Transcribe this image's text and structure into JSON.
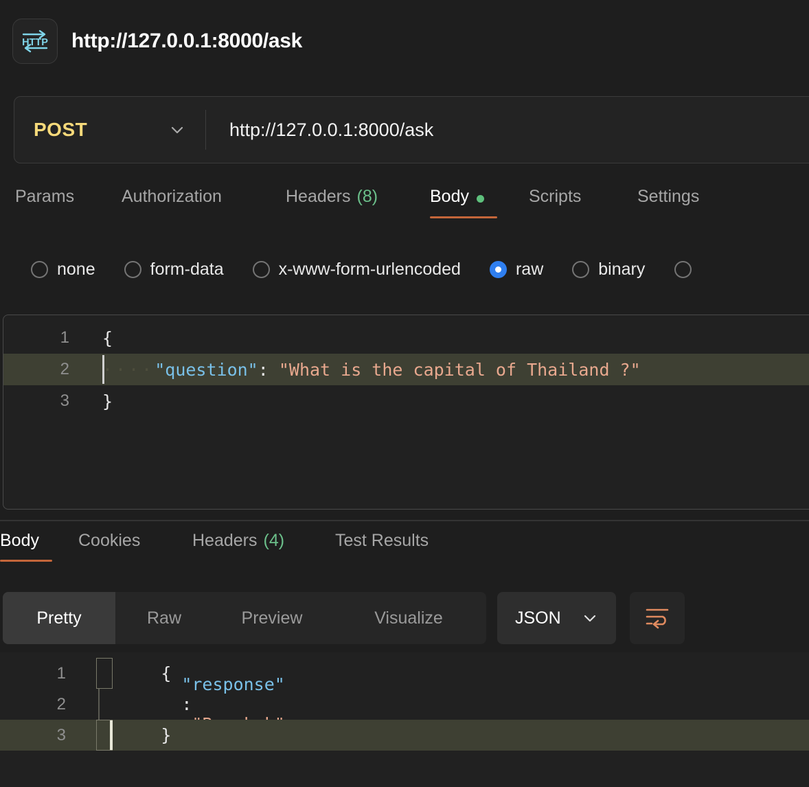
{
  "window": {
    "icon_name": "http-protocol-icon",
    "icon_text": "HTTP",
    "title": "http://127.0.0.1:8000/ask"
  },
  "url_bar": {
    "method": "POST",
    "method_chevron_icon": "chevron-down-icon",
    "url": "http://127.0.0.1:8000/ask"
  },
  "request_tabs": [
    {
      "label": "Params",
      "active": false
    },
    {
      "label": "Authorization",
      "active": false
    },
    {
      "label": "Headers",
      "count": "(8)",
      "active": false
    },
    {
      "label": "Body",
      "active": true,
      "dot": true
    },
    {
      "label": "Scripts",
      "active": false
    },
    {
      "label": "Settings",
      "active": false
    }
  ],
  "body_types": [
    {
      "label": "none",
      "selected": false
    },
    {
      "label": "form-data",
      "selected": false
    },
    {
      "label": "x-www-form-urlencoded",
      "selected": false
    },
    {
      "label": "raw",
      "selected": true
    },
    {
      "label": "binary",
      "selected": false
    }
  ],
  "request_body": {
    "lines": [
      {
        "num": "1",
        "indent_dots": "",
        "key": "",
        "colon": "",
        "value": "",
        "brace": "{",
        "highlight": false
      },
      {
        "num": "2",
        "indent_dots": "····",
        "key": "\"question\"",
        "colon": ":",
        "value": " \"What is the capital of Thailand ?\"",
        "brace": "",
        "highlight": true
      },
      {
        "num": "3",
        "indent_dots": "",
        "key": "",
        "colon": "",
        "value": "",
        "brace": "}",
        "highlight": false
      }
    ]
  },
  "response_tabs": [
    {
      "label": "Body",
      "active": true
    },
    {
      "label": "Cookies",
      "active": false
    },
    {
      "label": "Headers",
      "count": "(4)",
      "active": false
    },
    {
      "label": "Test Results",
      "active": false
    }
  ],
  "response_toolbar": {
    "views": [
      {
        "label": "Pretty",
        "active": true
      },
      {
        "label": "Raw",
        "active": false
      },
      {
        "label": "Preview",
        "active": false
      },
      {
        "label": "Visualize",
        "active": false
      }
    ],
    "format": "JSON",
    "format_chevron_icon": "chevron-down-icon",
    "wrap_icon": "word-wrap-icon"
  },
  "response_body": {
    "lines": [
      {
        "num": "1",
        "key": "",
        "colon": "",
        "value": "",
        "brace": "{",
        "highlight": false
      },
      {
        "num": "2",
        "key": "\"response\"",
        "colon": ":",
        "value": " \"Bangkok\"",
        "brace": "",
        "highlight": false
      },
      {
        "num": "3",
        "key": "",
        "colon": "",
        "value": "",
        "brace": "}",
        "highlight": true
      }
    ]
  },
  "colors": {
    "accent_underline": "#c4663a",
    "method": "#f5d97a",
    "count_green": "#6bbf8a",
    "radio_selected": "#2f7ff0",
    "json_key": "#79c0e8",
    "json_string": "#e8a88e",
    "line_highlight": "#3e4033",
    "icon_cyan": "#7fd4e8"
  }
}
